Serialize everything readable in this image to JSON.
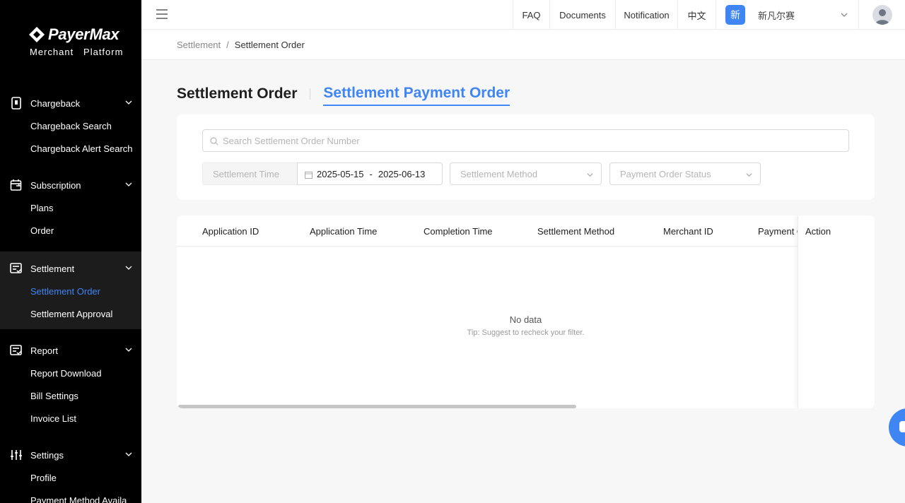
{
  "brand": {
    "name": "PayerMax",
    "subtitle": "Merchant   Platform"
  },
  "sidebar": {
    "groups": [
      {
        "label": "Chargeback",
        "icon": "phone-card-icon",
        "items": [
          "Chargeback Search",
          "Chargeback Alert Search"
        ]
      },
      {
        "label": "Subscription",
        "icon": "calendar-repeat-icon",
        "items": [
          "Plans",
          "Order"
        ]
      },
      {
        "label": "Settlement",
        "icon": "settlement-doc-icon",
        "items": [
          "Settlement Order",
          "Settlement Approval"
        ],
        "active": true,
        "current_item": "Settlement Order"
      },
      {
        "label": "Report",
        "icon": "report-doc-icon",
        "items": [
          "Report Download",
          "Bill Settings",
          "Invoice List"
        ]
      },
      {
        "label": "Settings",
        "icon": "sliders-icon",
        "items": [
          "Profile",
          "Payment Method Availa"
        ]
      }
    ]
  },
  "topbar": {
    "faq": "FAQ",
    "documents": "Documents",
    "notification": "Notification",
    "language": "中文",
    "merchant_badge": "新",
    "merchant_name": "新凡尔赛"
  },
  "breadcrumb": {
    "parent": "Settlement",
    "separator": "/",
    "current": "Settlement Order"
  },
  "tabs": {
    "tab1": "Settlement Order",
    "tab2": "Settlement Payment Order",
    "active": "Settlement Payment Order"
  },
  "filters": {
    "search_placeholder": "Search Settlement Order Number",
    "time_label": "Settlement Time",
    "date_start": "2025-05-15",
    "date_sep": "-",
    "date_end": "2025-06-13",
    "method_placeholder": "Settlement Method",
    "status_placeholder": "Payment Order Status"
  },
  "table": {
    "columns": [
      "Application ID",
      "Application Time",
      "Completion Time",
      "Settlement Method",
      "Merchant ID",
      "Payment O"
    ],
    "action_column": "Action",
    "rows": [],
    "empty_title": "No data",
    "empty_tip": "Tip: Suggest to recheck your filter."
  },
  "colors": {
    "accent": "#3f85f3",
    "sidebar_bg": "#000000",
    "sidebar_active_bg": "#1c1c1c"
  }
}
